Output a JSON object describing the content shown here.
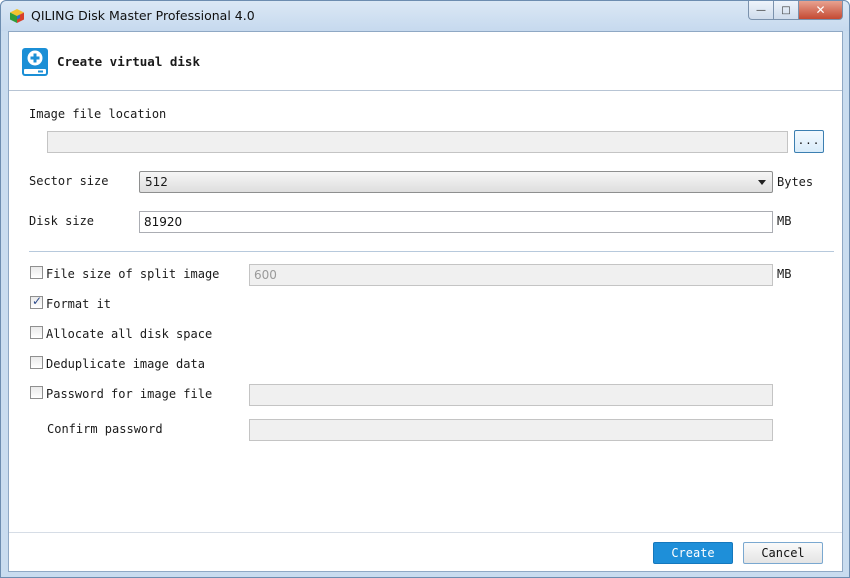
{
  "window": {
    "title": "QILING Disk Master Professional 4.0",
    "controls": {
      "minimize": "—",
      "maximize": "□",
      "close": "✕"
    }
  },
  "header": {
    "title": "Create virtual disk",
    "icon": "add-disk-icon"
  },
  "form": {
    "image_location": {
      "label": "Image file location",
      "value": "",
      "browse_label": "..."
    },
    "sector_size": {
      "label": "Sector size",
      "value": "512",
      "unit": "Bytes"
    },
    "disk_size": {
      "label": "Disk size",
      "value": "81920",
      "unit": "MB"
    },
    "split_image": {
      "label": "File size of split image",
      "checked": false,
      "value": "600",
      "unit": "MB"
    },
    "format_it": {
      "label": "Format it",
      "checked": true
    },
    "allocate_all": {
      "label": "Allocate all disk space",
      "checked": false
    },
    "deduplicate": {
      "label": "Deduplicate image data",
      "checked": false
    },
    "password": {
      "label": "Password for image file",
      "checked": false,
      "value": ""
    },
    "confirm_password": {
      "label": "Confirm password",
      "value": ""
    }
  },
  "footer": {
    "create_label": "Create",
    "cancel_label": "Cancel"
  },
  "colors": {
    "accent": "#1e8fd9",
    "titlebar": "#c9dcef",
    "close": "#c44a33"
  }
}
